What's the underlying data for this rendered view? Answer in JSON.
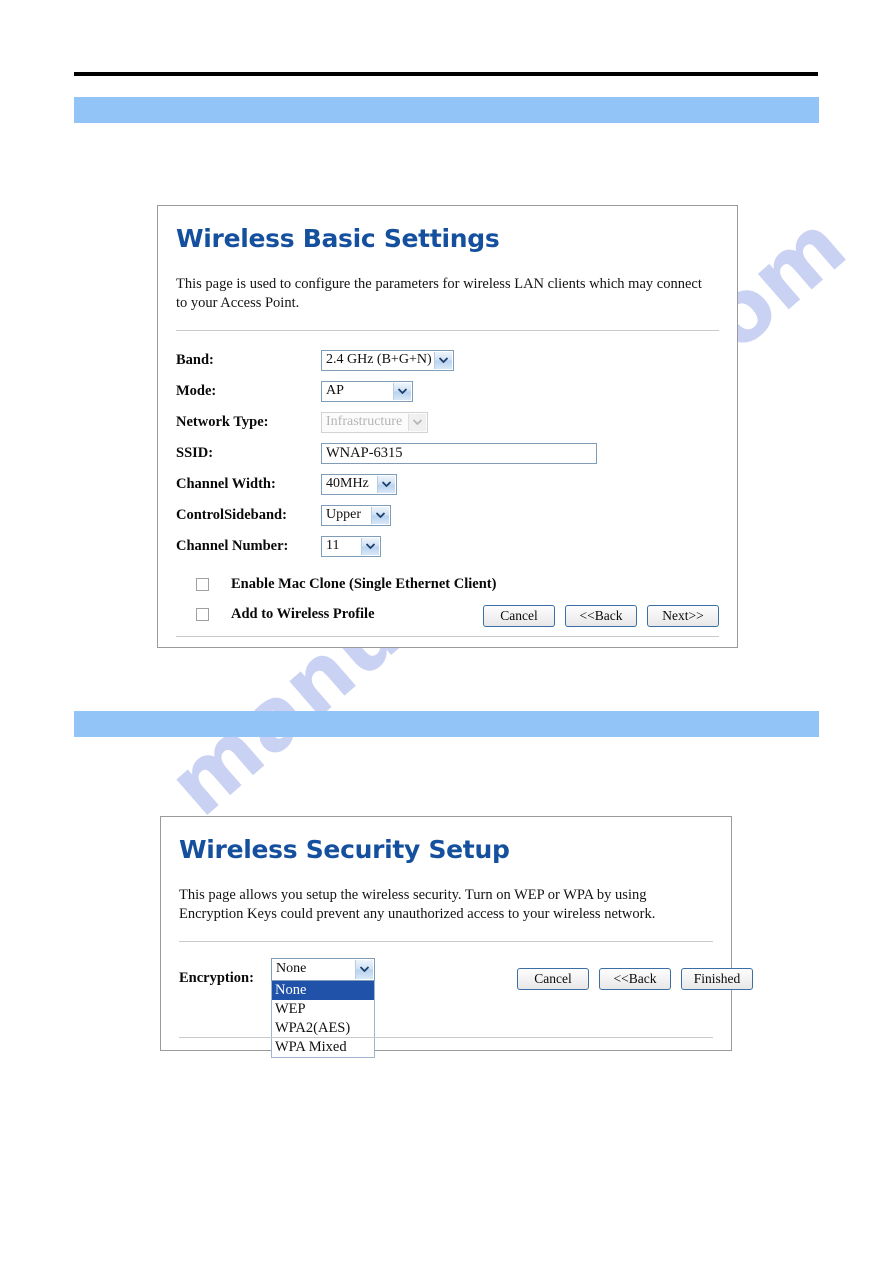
{
  "page": {
    "watermark_text": "manualshive.com",
    "accent_blue": "#15509e",
    "bar_blue": "#93c4f7",
    "highlight_blue": "#1f52a8"
  },
  "basic_settings": {
    "title": "Wireless  Basic Settings",
    "description": "This page is used to configure the parameters for wireless LAN clients which may connect to your Access Point.",
    "fields": [
      {
        "label": "Band:",
        "value": "2.4 GHz (B+G+N)",
        "type": "select",
        "disabled": false
      },
      {
        "label": "Mode:",
        "value": "AP",
        "type": "select",
        "disabled": false
      },
      {
        "label": "Network Type:",
        "value": "Infrastructure",
        "type": "select",
        "disabled": true
      },
      {
        "label": "SSID:",
        "value": "WNAP-6315",
        "type": "text",
        "disabled": false
      },
      {
        "label": "Channel Width:",
        "value": "40MHz",
        "type": "select",
        "disabled": false
      },
      {
        "label": "ControlSideband:",
        "value": "Upper",
        "type": "select",
        "disabled": false
      },
      {
        "label": "Channel Number:",
        "value": "11",
        "type": "select",
        "disabled": false
      }
    ],
    "checkboxes": [
      {
        "label": "Enable Mac Clone (Single Ethernet Client)",
        "checked": false
      },
      {
        "label": "Add to Wireless Profile",
        "checked": false
      }
    ],
    "buttons": [
      {
        "label": "Cancel"
      },
      {
        "label": "<<Back"
      },
      {
        "label": "Next>>"
      }
    ]
  },
  "security_setup": {
    "title": "Wireless  Security Setup",
    "description": "This page allows you setup the wireless security. Turn on WEP or WPA by using Encryption Keys could prevent any unauthorized access to your wireless network.",
    "encryption": {
      "label": "Encryption:",
      "selected_value": "None",
      "options": [
        {
          "label": "None",
          "selected": true
        },
        {
          "label": "WEP",
          "selected": false
        },
        {
          "label": "WPA2(AES)",
          "selected": false
        },
        {
          "label": "WPA Mixed",
          "selected": false
        }
      ]
    },
    "buttons": [
      {
        "label": "Cancel"
      },
      {
        "label": "<<Back"
      },
      {
        "label": "Finished"
      }
    ]
  }
}
